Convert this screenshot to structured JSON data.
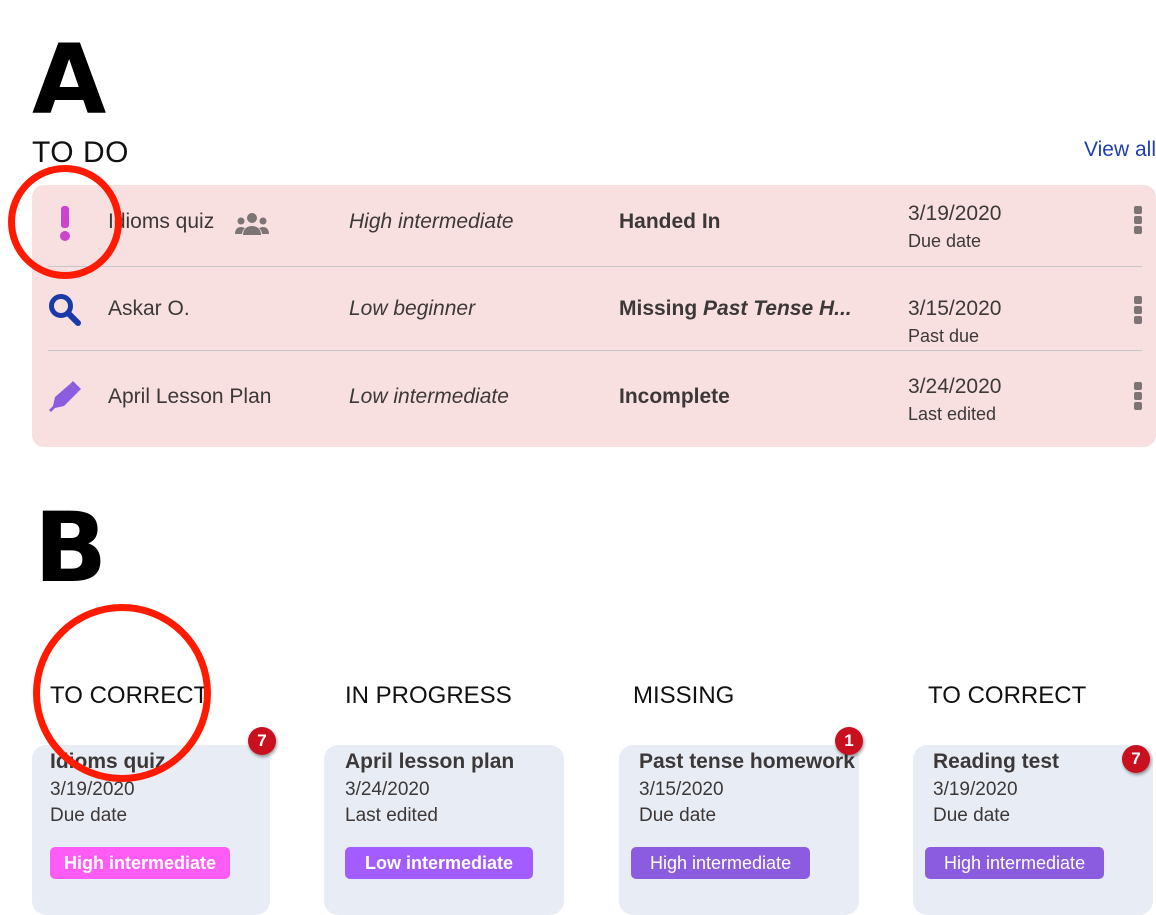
{
  "labels": {
    "a": "A",
    "b": "B"
  },
  "todo": {
    "title": "TO DO",
    "view_all": "View all",
    "rows": [
      {
        "icon": "exclamation-icon",
        "name": "Idioms quiz",
        "group_icon": "users-icon",
        "level": "High intermediate",
        "status": "Handed In",
        "date": "3/19/2020",
        "date_label": "Due date"
      },
      {
        "icon": "search-icon",
        "name": "Askar O.",
        "level": "Low beginner",
        "status_prefix": "Missing",
        "status_italic": "Past Tense H...",
        "date": "3/15/2020",
        "date_label": "Past due"
      },
      {
        "icon": "pen-icon",
        "name": "April Lesson Plan",
        "level": "Low intermediate",
        "status": "Incomplete",
        "date": "3/24/2020",
        "date_label": "Last edited"
      }
    ]
  },
  "board": {
    "columns": [
      {
        "header": "TO CORRECT",
        "title": "Idioms quiz",
        "date": "3/19/2020",
        "date_label": "Due date",
        "level": "High intermediate",
        "badge": "7",
        "pill_color": "#ff5cf5"
      },
      {
        "header": "IN PROGRESS",
        "title": "April lesson plan",
        "date": "3/24/2020",
        "date_label": "Last edited",
        "level": "Low intermediate",
        "pill_color": "#a25cff"
      },
      {
        "header": "MISSING",
        "title": "Past tense homework",
        "date": "3/15/2020",
        "date_label": "Due date",
        "level": "High intermediate",
        "badge": "1",
        "pill_color": "#8c5ce0"
      },
      {
        "header": "TO CORRECT",
        "title": "Reading test",
        "date": "3/19/2020",
        "date_label": "Due date",
        "level": "High intermediate",
        "badge": "7",
        "pill_color": "#8c5ce0"
      }
    ]
  },
  "colors": {
    "panel": "#f8e0e1",
    "card": "#e8ecf5",
    "link": "#1f3fb0",
    "badge": "#c8101e",
    "highlight_ring": "#ff1a00"
  }
}
